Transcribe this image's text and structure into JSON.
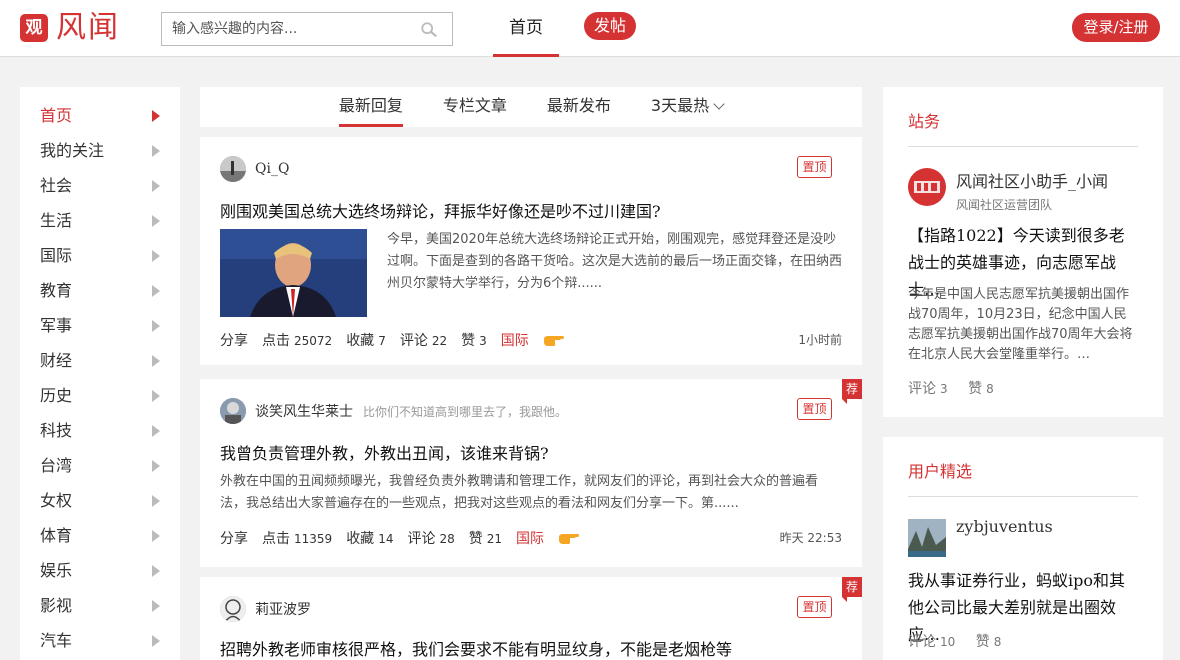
{
  "header": {
    "logo_mark": "观",
    "logo_text": "风闻",
    "search_placeholder": "输入感兴趣的内容...",
    "nav_home": "首页",
    "post_button": "发帖",
    "login_button": "登录/注册"
  },
  "leftnav": {
    "items": [
      {
        "label": "首页",
        "active": true
      },
      {
        "label": "我的关注"
      },
      {
        "label": "社会"
      },
      {
        "label": "生活"
      },
      {
        "label": "国际"
      },
      {
        "label": "教育"
      },
      {
        "label": "军事"
      },
      {
        "label": "财经"
      },
      {
        "label": "历史"
      },
      {
        "label": "科技"
      },
      {
        "label": "台湾"
      },
      {
        "label": "女权"
      },
      {
        "label": "体育"
      },
      {
        "label": "娱乐"
      },
      {
        "label": "影视"
      },
      {
        "label": "汽车"
      }
    ]
  },
  "tabs": [
    {
      "label": "最新回复",
      "active": true
    },
    {
      "label": "专栏文章"
    },
    {
      "label": "最新发布"
    },
    {
      "label": "3天最热",
      "dropdown": true
    }
  ],
  "feed": [
    {
      "author": "Qi_Q",
      "signature": "",
      "pin_label": "置顶",
      "recommended": false,
      "title": "刚围观美国总统大选终场辩论，拜振华好像还是吵不过川建国?",
      "summary": "今早，美国2020年总统大选终场辩论正式开始，刚围观完，感觉拜登还是没吵过啊。下面是查到的各路干货哈。这次是大选前的最后一场正面交锋，在田纳西州贝尔蒙特大学举行，分为6个辩......",
      "share": "分享",
      "clicks_label": "点击",
      "clicks": "25072",
      "fav_label": "收藏",
      "favs": "7",
      "comment_label": "评论",
      "comments": "22",
      "like_label": "赞",
      "likes": "3",
      "tag": "国际",
      "time": "1小时前"
    },
    {
      "author": "谈笑风生华莱士",
      "signature": "比你们不知道高到哪里去了，我跟他。",
      "pin_label": "置顶",
      "recommended": true,
      "rec_label": "荐",
      "title": "我曾负责管理外教，外教出丑闻，该谁来背锅?",
      "summary": "外教在中国的丑闻频频曝光，我曾经负责外教聘请和管理工作，就网友们的评论，再到社会大众的普遍看法，我总结出大家普遍存在的一些观点，把我对这些观点的看法和网友们分享一下。第......",
      "share": "分享",
      "clicks_label": "点击",
      "clicks": "11359",
      "fav_label": "收藏",
      "favs": "14",
      "comment_label": "评论",
      "comments": "28",
      "like_label": "赞",
      "likes": "21",
      "tag": "国际",
      "time": "昨天 22:53"
    },
    {
      "author": "莉亚波罗",
      "signature": "",
      "pin_label": "置顶",
      "recommended": true,
      "rec_label": "荐",
      "title": "招聘外教老师审核很严格，我们会要求不能有明显纹身，不能是老烟枪等"
    }
  ],
  "panels": [
    {
      "title": "站务",
      "user_name": "风闻社区小助手_小闻",
      "user_sub": "风闻社区运营团队",
      "post_title": "【指路1022】今天读到很多老战士的英雄事迹，向志愿军战士…",
      "post_summary": "今年是中国人民志愿军抗美援朝出国作战70周年，10月23日，纪念中国人民志愿军抗美援朝出国作战70周年大会将在北京人民大会堂隆重举行。…",
      "comment_label": "评论",
      "comments": "3",
      "like_label": "赞",
      "likes": "8"
    },
    {
      "title": "用户精选",
      "user_name": "zybjuventus",
      "post_title": "我从事证券行业，蚂蚁ipo和其他公司比最大差别就是出圈效应…",
      "comment_label": "评论",
      "comments": "10",
      "like_label": "赞",
      "likes": "8"
    }
  ],
  "colors": {
    "accent": "#d53333",
    "background": "#f2f2f2"
  }
}
